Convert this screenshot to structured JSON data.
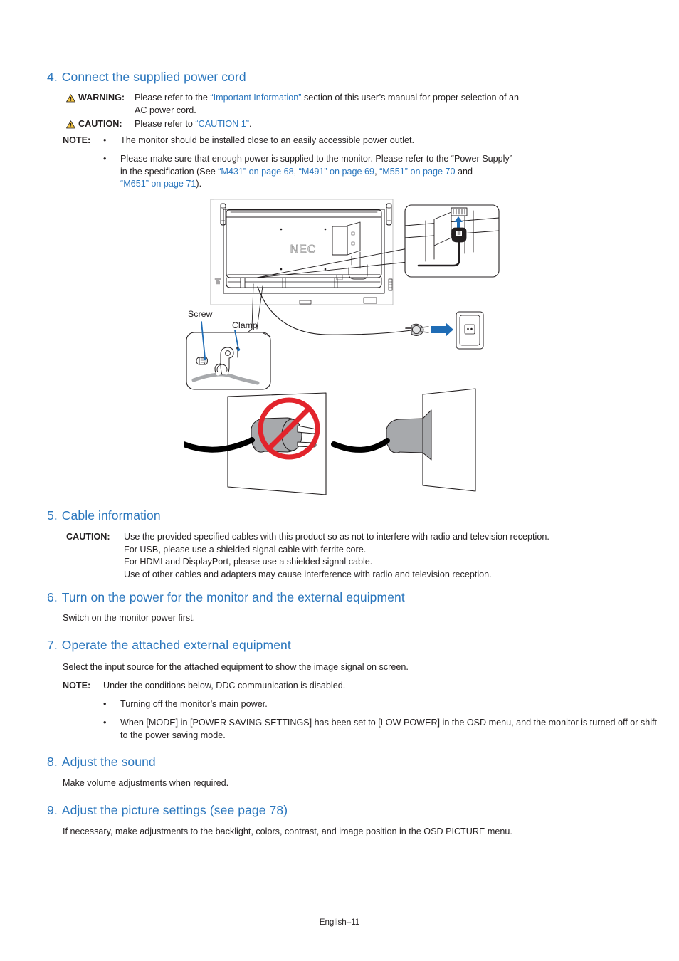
{
  "document": {
    "footer": "English–11",
    "heading_color": "#2a76bd",
    "link_color": "#2a76bd",
    "body_color": "#231f20",
    "warning_icon_color": "#f5c518"
  },
  "sections": [
    {
      "number": "4.",
      "title": "Connect the supplied power cord",
      "warning": {
        "label": "WARNING:",
        "icon": "warning-triangle-icon",
        "text_before": "Please refer to the ",
        "link": "“Important Information”",
        "text_after": " section of this user’s manual for proper selection of an",
        "line2": "AC power cord."
      },
      "caution": {
        "label": "CAUTION:",
        "icon": "warning-triangle-icon",
        "text_before": "Please refer to ",
        "link": "“CAUTION 1”",
        "text_after": "."
      },
      "note": {
        "label": "NOTE:",
        "bullet": "•",
        "items": [
          {
            "text": "The monitor should be installed close to an easily accessible power outlet."
          },
          {
            "line1": "Please make sure that enough power is supplied to the monitor. Please refer to the “Power Supply”",
            "line2_prefix": "in the specification (See ",
            "link1": "“M431” on page 68",
            "sep1": ", ",
            "link2": "“M491” on page 69",
            "sep2": ", ",
            "link3": "“M551” on page 70",
            "sep3": " and",
            "link4": "“M651” on page 71",
            "line3_suffix": ")."
          }
        ]
      }
    },
    {
      "number": "5.",
      "title": "Cable information",
      "caution_block": {
        "label": "CAUTION:",
        "lines": [
          "Use the provided specified cables with this product so as not to interfere with radio and television reception.",
          "For USB, please use a shielded signal cable with ferrite core.",
          "For HDMI and DisplayPort, please use a shielded signal cable.",
          "Use of other cables and adapters may cause interference with radio and television reception."
        ]
      }
    },
    {
      "number": "6.",
      "title": "Turn on the power for the monitor and the external equipment",
      "paragraph": "Switch on the monitor power first."
    },
    {
      "number": "7.",
      "title": "Operate the attached external equipment",
      "paragraph": "Select the input source for the attached equipment to show the image signal on screen.",
      "note": {
        "label": "NOTE:",
        "intro": "Under the conditions below, DDC communication is disabled.",
        "bullet": "•",
        "items": [
          "Turning off the monitor’s main power.",
          "When [MODE] in [POWER SAVING SETTINGS] has been set to [LOW POWER] in the OSD menu, and the monitor is turned off or shift to the power saving mode."
        ]
      }
    },
    {
      "number": "8.",
      "title": "Adjust the sound",
      "paragraph": "Make volume adjustments when required."
    },
    {
      "number": "9.",
      "title": "Adjust the picture settings (see page 78)",
      "paragraph": "If necessary, make adjustments to the backlight, colors, contrast, and image position in the OSD PICTURE menu."
    }
  ],
  "figure": {
    "brand_logo": "NEC",
    "labels": {
      "screw": "Screw",
      "clamp": "Clamp"
    },
    "colors": {
      "arrow_blue": "#1f6cb5",
      "leader_blue": "#1f6cb5",
      "prohibit_red": "#e2242c",
      "plug_grey": "#a7a9ac",
      "cable_black": "#000000",
      "outline": "#231f20"
    }
  }
}
